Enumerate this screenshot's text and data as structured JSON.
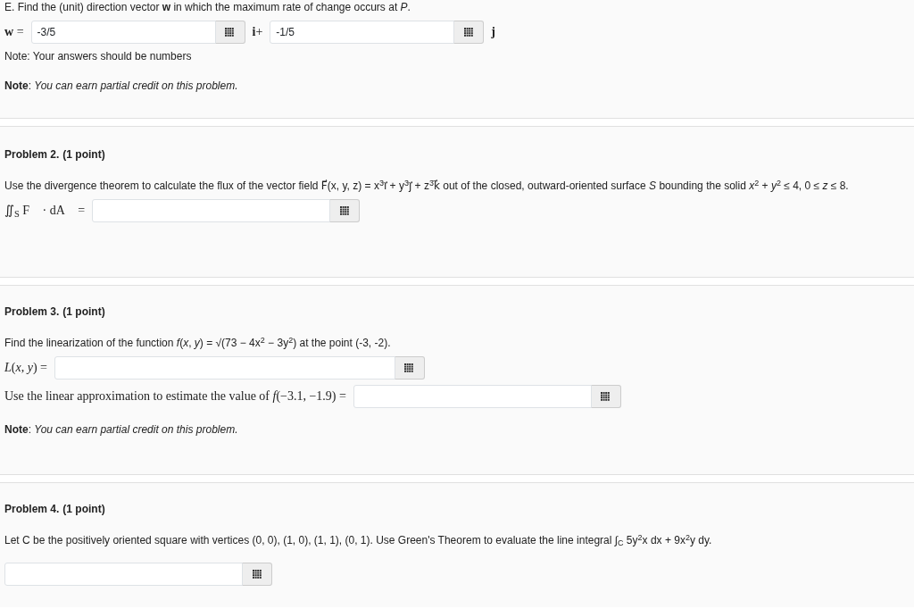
{
  "sections": [
    {
      "lines": [
        {
          "kind": "text",
          "text": "E. Find the (unit) direction vector **w** in which the maximum rate of change occurs at *P*."
        },
        {
          "kind": "row",
          "items": [
            {
              "kind": "math",
              "text": "**w** ="
            },
            {
              "kind": "field",
              "value": "-3/5"
            },
            {
              "kind": "math",
              "text": "**i**+"
            },
            {
              "kind": "field",
              "value": "-1/5"
            },
            {
              "kind": "math",
              "text": "**j**"
            }
          ]
        },
        {
          "kind": "text",
          "text": "Note: Your answers should be numbers"
        },
        {
          "kind": "note",
          "text": "**Note**: *You can earn partial credit on this problem.*"
        }
      ]
    },
    {
      "title": "Problem 2.",
      "points": "(1 point)",
      "lines": [
        {
          "kind": "text",
          "text": "Use the divergence theorem to calculate the flux of the vector field F⃗(x, y, z) = x$^{3}$i⃗ + y$^{3}$j⃗ + z$^{3}$k⃗ out of the closed, outward-oriented surface *S* bounding the solid *x*$^{2}$ + *y*$^{2}$ ≤ 4, 0 ≤ *z* ≤ 8."
        },
        {
          "kind": "row",
          "items": [
            {
              "kind": "math",
              "text": "∬$_{S}$ F⃗ · dA⃗ ="
            },
            {
              "kind": "field"
            }
          ]
        }
      ]
    },
    {
      "title": "Problem 3.",
      "points": "(1 point)",
      "lines": [
        {
          "kind": "text",
          "text": "Find the linearization of the function *f*(*x*, *y*) = √(73 − 4x$^{2}$ − 3y$^{2}$) at the point (-3, -2)."
        },
        {
          "kind": "row",
          "items": [
            {
              "kind": "math",
              "text": "*L*(*x*, *y*) ="
            },
            {
              "kind": "field"
            }
          ]
        },
        {
          "kind": "row",
          "items": [
            {
              "kind": "math",
              "text": "Use the linear approximation to estimate the value of *f*(−3.1, −1.9) ="
            },
            {
              "kind": "field"
            }
          ]
        },
        {
          "kind": "note",
          "text": "**Note**: *You can earn partial credit on this problem.*"
        }
      ]
    },
    {
      "title": "Problem 4.",
      "points": "(1 point)",
      "lines": [
        {
          "kind": "text",
          "text": "Let C be the positively oriented square with vertices (0, 0), (1, 0), (1, 1), (0, 1). Use Green's Theorem to evaluate the line integral ∫$_{C}$ 5y$^{2}$x dx + 9x$^{2}$y dy."
        },
        {
          "kind": "row",
          "items": [
            {
              "kind": "field"
            }
          ]
        }
      ]
    }
  ]
}
